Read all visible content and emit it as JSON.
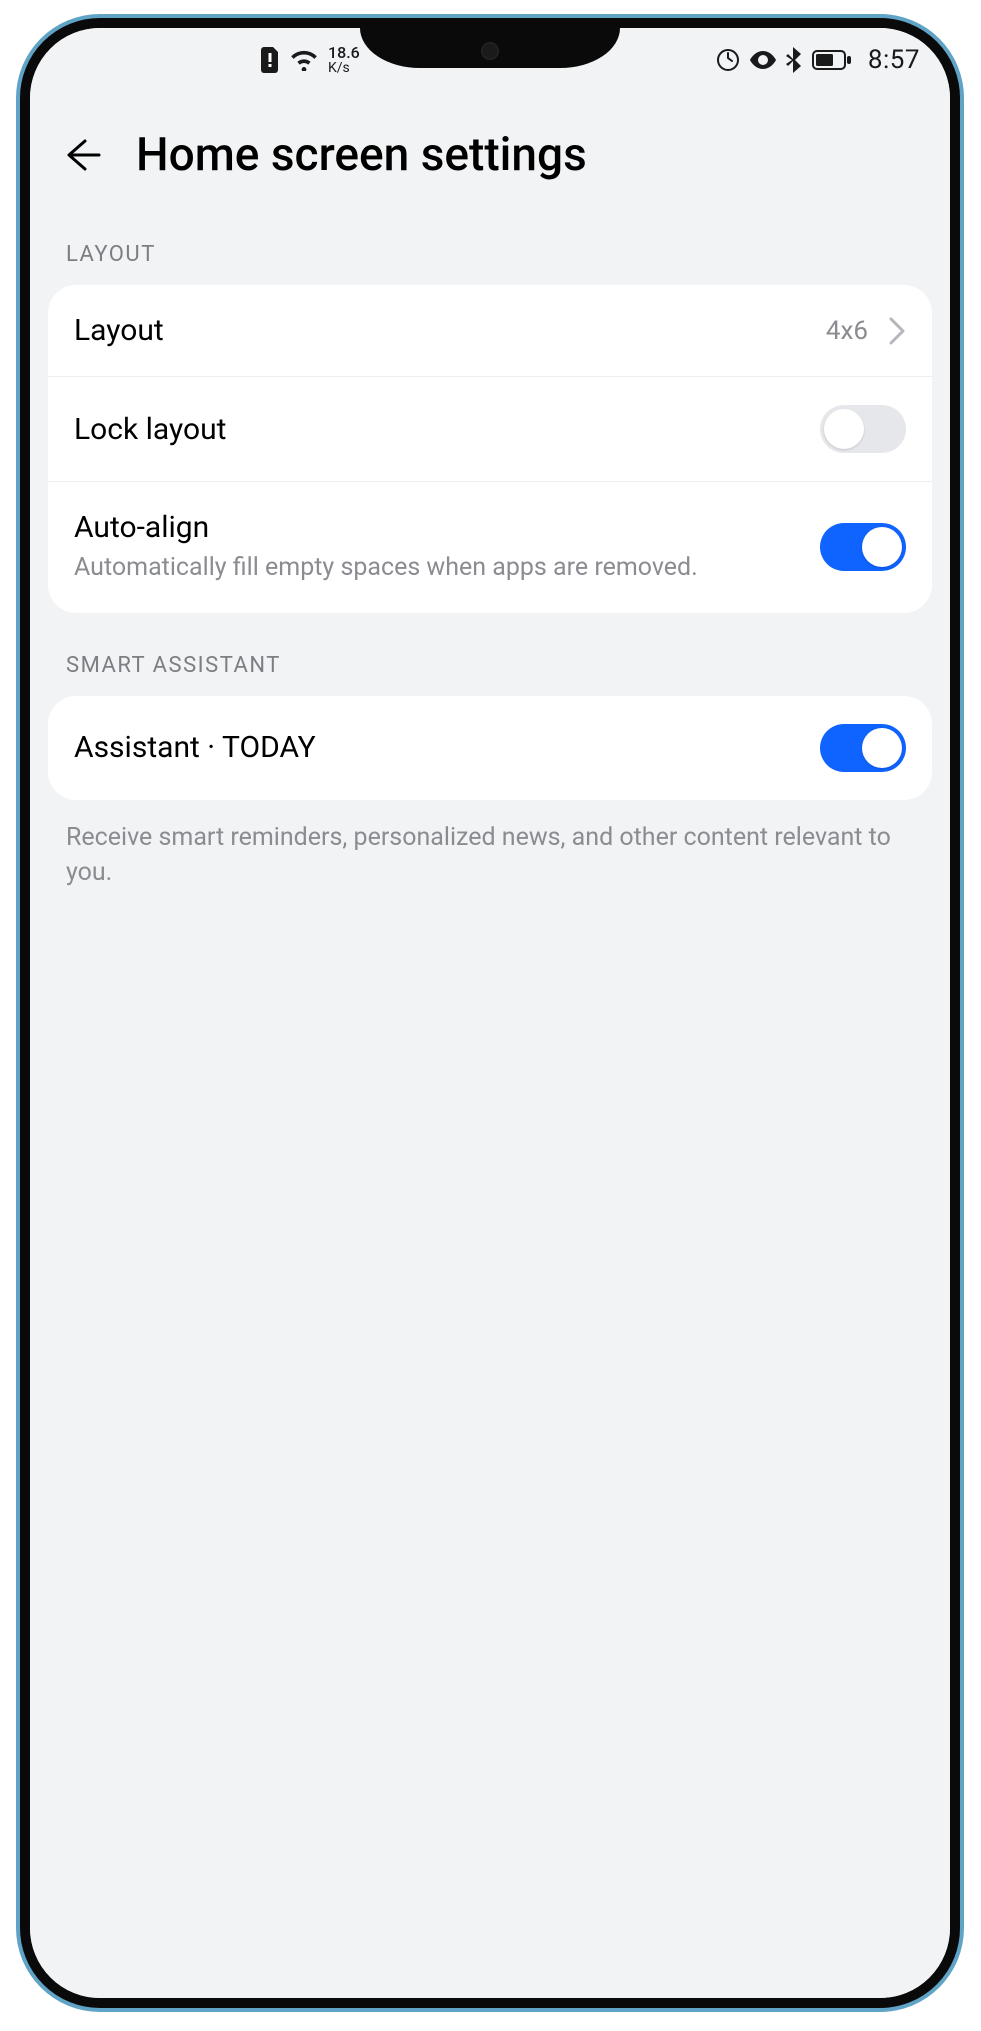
{
  "status": {
    "speed_value": "18.6",
    "speed_unit": "K/s",
    "time": "8:57"
  },
  "header": {
    "title": "Home screen settings"
  },
  "sections": {
    "layout": {
      "label": "LAYOUT",
      "rows": {
        "layout": {
          "title": "Layout",
          "value": "4x6"
        },
        "lock": {
          "title": "Lock layout",
          "on": false
        },
        "autoalign": {
          "title": "Auto-align",
          "sub": "Automatically fill empty spaces when apps are removed.",
          "on": true
        }
      }
    },
    "assistant": {
      "label": "SMART ASSISTANT",
      "rows": {
        "today": {
          "title": "Assistant · TODAY",
          "on": true
        }
      },
      "footnote": "Receive smart reminders, personalized news, and other content relevant to you."
    }
  }
}
